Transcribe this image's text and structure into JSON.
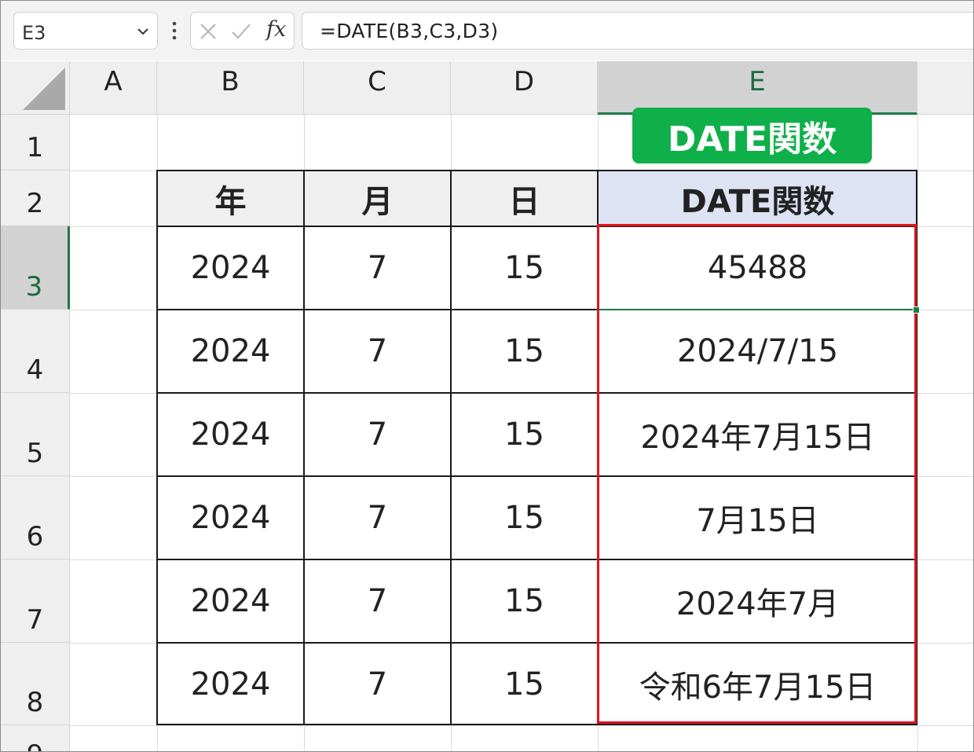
{
  "formula_bar": {
    "name_box": "E3",
    "fx_label": "fx",
    "formula": "=DATE(B3,C3,D3)"
  },
  "columns": [
    "A",
    "B",
    "C",
    "D",
    "E"
  ],
  "rows": [
    "1",
    "2",
    "3",
    "4",
    "5",
    "6",
    "7",
    "8",
    "9"
  ],
  "selected_column": "E",
  "selected_row": "3",
  "callout_label": "DATE関数",
  "table": {
    "headers": [
      "年",
      "月",
      "日",
      "DATE関数"
    ],
    "rows": [
      [
        "2024",
        "7",
        "15",
        "45488"
      ],
      [
        "2024",
        "7",
        "15",
        "2024/7/15"
      ],
      [
        "2024",
        "7",
        "15",
        "2024年7月15日"
      ],
      [
        "2024",
        "7",
        "15",
        "7月15日"
      ],
      [
        "2024",
        "7",
        "15",
        "2024年7月"
      ],
      [
        "2024",
        "7",
        "15",
        "令和6年7月15日"
      ]
    ]
  },
  "colors": {
    "header_fill": "#efefef",
    "date_header_fill": "#dde3f3",
    "callout_green": "#0fb04a",
    "highlight_red": "#e0141e",
    "excel_green": "#1e7a45"
  }
}
